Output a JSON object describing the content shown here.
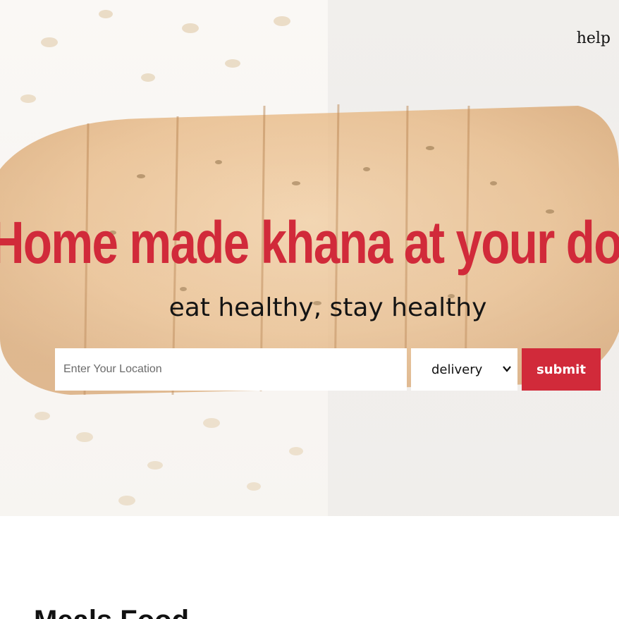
{
  "header": {
    "help_label": "help"
  },
  "hero": {
    "headline": "Home made khana at your door",
    "tagline": "eat healthy, stay healthy",
    "background_image": "sliced bread loaf with oats"
  },
  "search": {
    "location_placeholder": "Enter Your Location",
    "location_value": "",
    "mode_selected": "delivery",
    "submit_label": "submit"
  },
  "section": {
    "title": "Meals Food"
  },
  "colors": {
    "accent": "#d12a3a",
    "text": "#111111",
    "background": "#ffffff"
  },
  "icons": {
    "select_caret": "chevron-down-icon"
  }
}
